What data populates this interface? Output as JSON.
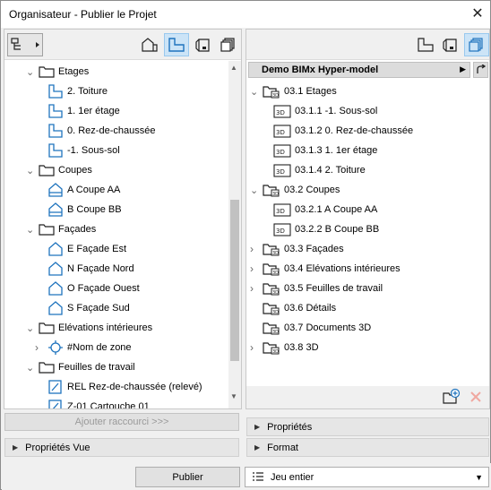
{
  "window": {
    "title": "Organisateur - Publier le Projet",
    "close_glyph": "✕"
  },
  "left_tree": {
    "items": [
      {
        "label": "Etages",
        "type": "folder",
        "expanded": true,
        "level": 0
      },
      {
        "label": "2. Toiture",
        "type": "plan",
        "level": 1
      },
      {
        "label": "1. 1er étage",
        "type": "plan",
        "level": 1
      },
      {
        "label": "0. Rez-de-chaussée",
        "type": "plan",
        "level": 1
      },
      {
        "label": "-1. Sous-sol",
        "type": "plan",
        "level": 1
      },
      {
        "label": "Coupes",
        "type": "folder",
        "expanded": true,
        "level": 0
      },
      {
        "label": "A Coupe AA",
        "type": "section",
        "level": 1
      },
      {
        "label": "B Coupe BB",
        "type": "section",
        "level": 1
      },
      {
        "label": "Façades",
        "type": "folder",
        "expanded": true,
        "level": 0
      },
      {
        "label": "E Façade Est",
        "type": "elevation",
        "level": 1
      },
      {
        "label": "N Façade Nord",
        "type": "elevation",
        "level": 1
      },
      {
        "label": "O Façade Ouest",
        "type": "elevation",
        "level": 1
      },
      {
        "label": "S Façade Sud",
        "type": "elevation",
        "level": 1
      },
      {
        "label": "Elévations intérieures",
        "type": "folder",
        "expanded": true,
        "level": 0
      },
      {
        "label": "#Nom de zone",
        "type": "zone",
        "collapsed": true,
        "level": 1
      },
      {
        "label": "Feuilles de travail",
        "type": "folder",
        "expanded": true,
        "level": 0
      },
      {
        "label": "REL Rez-de-chaussée (relevé)",
        "type": "worksheet",
        "level": 1
      },
      {
        "label": "Z-01 Cartouche 01",
        "type": "worksheet",
        "level": 1
      }
    ]
  },
  "left_buttons": {
    "add_shortcut": "Ajouter raccourci >>>",
    "view_properties": "Propriétés Vue"
  },
  "right_header": {
    "model_name": "Demo BIMx Hyper-model"
  },
  "right_tree": {
    "items": [
      {
        "label": "03.1 Etages",
        "type": "set",
        "expanded": true,
        "level": 0
      },
      {
        "label": "03.1.1 -1. Sous-sol",
        "type": "item",
        "level": 1
      },
      {
        "label": "03.1.2 0. Rez-de-chaussée",
        "type": "item",
        "level": 1
      },
      {
        "label": "03.1.3 1. 1er étage",
        "type": "item",
        "level": 1
      },
      {
        "label": "03.1.4 2. Toiture",
        "type": "item",
        "level": 1
      },
      {
        "label": "03.2 Coupes",
        "type": "set",
        "expanded": true,
        "level": 0
      },
      {
        "label": "03.2.1 A Coupe AA",
        "type": "item",
        "level": 1
      },
      {
        "label": "03.2.2 B Coupe BB",
        "type": "item",
        "level": 1
      },
      {
        "label": "03.3 Façades",
        "type": "set",
        "expanded": false,
        "level": 0
      },
      {
        "label": "03.4 Elévations intérieures",
        "type": "set",
        "expanded": false,
        "level": 0
      },
      {
        "label": "03.5 Feuilles de travail",
        "type": "set",
        "expanded": false,
        "level": 0
      },
      {
        "label": "03.6 Détails",
        "type": "set",
        "expanded": null,
        "level": 0
      },
      {
        "label": "03.7 Documents 3D",
        "type": "set",
        "expanded": null,
        "level": 0
      },
      {
        "label": "03.8 3D",
        "type": "set",
        "expanded": false,
        "level": 0
      }
    ]
  },
  "right_sections": {
    "properties": "Propriétés",
    "format": "Format"
  },
  "bottom": {
    "publish_label": "Publier",
    "scope_label": "Jeu entier"
  },
  "colors": {
    "accent": "#1e73be",
    "active_bg": "#cce4f7",
    "delete_red": "#e04a3a"
  }
}
